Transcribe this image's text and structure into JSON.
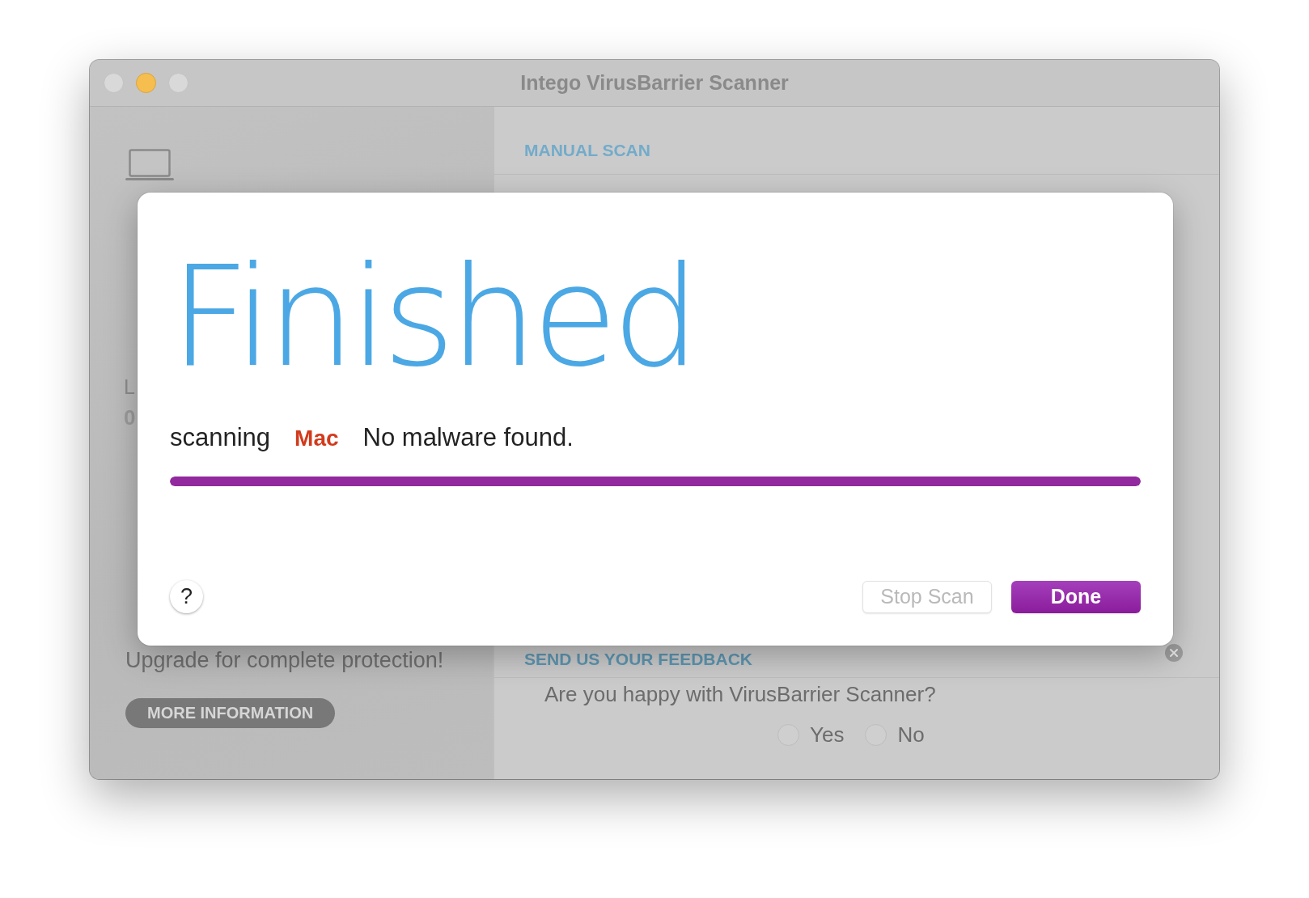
{
  "window": {
    "title": "Intego VirusBarrier Scanner",
    "controls": [
      {
        "kind": "close",
        "enabled": false
      },
      {
        "kind": "minimize",
        "enabled": true
      },
      {
        "kind": "zoom",
        "enabled": false
      }
    ]
  },
  "sidebar": {
    "fragments": [
      {
        "kind": "label",
        "text": "L"
      },
      {
        "kind": "value",
        "text": "0"
      }
    ],
    "promo": "Upgrade for complete protection!",
    "more_button": "MORE INFORMATION"
  },
  "main": {
    "section_title": "MANUAL SCAN",
    "feedback": {
      "title": "SEND US YOUR FEEDBACK",
      "question": "Are you happy with VirusBarrier Scanner?",
      "options": [
        {
          "label": "Yes",
          "selected": false
        },
        {
          "label": "No",
          "selected": false
        }
      ]
    }
  },
  "dialog": {
    "heading": "Finished",
    "status": {
      "action": "scanning",
      "target": "Mac",
      "result": "No malware found."
    },
    "progress": {
      "level": 1
    },
    "help_label": "?",
    "buttons": [
      {
        "kind": "secondary",
        "label": "Stop Scan",
        "disabled": true
      },
      {
        "kind": "primary",
        "label": "Done",
        "disabled": false
      }
    ]
  }
}
